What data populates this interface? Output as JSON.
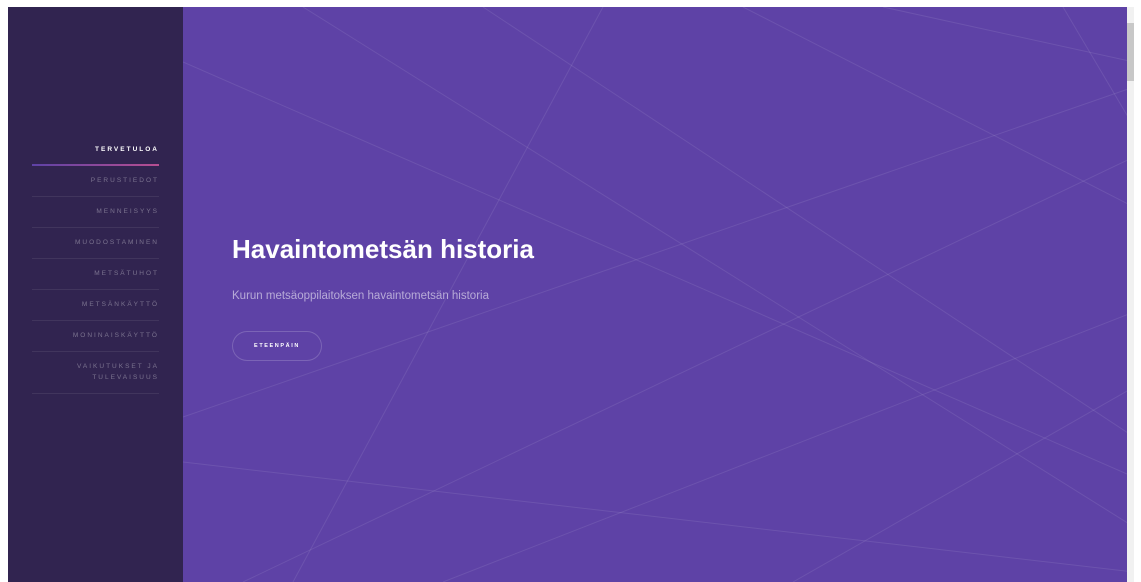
{
  "sidebar": {
    "items": [
      {
        "label": "TERVETULOA"
      },
      {
        "label": "PERUSTIEDOT"
      },
      {
        "label": "MENNEISYYS"
      },
      {
        "label": "MUODOSTAMINEN"
      },
      {
        "label": "METSÄTUHOT"
      },
      {
        "label": "METSÄNKÄYTTÖ"
      },
      {
        "label": "MONINAISKÄYTTÖ"
      },
      {
        "label": "VAIKUTUKSET JA TULEVAISUUS"
      }
    ],
    "active_index": 0
  },
  "hero": {
    "title": "Havaintometsän historia",
    "subtitle": "Kurun metsäoppilaitoksen havaintometsän historia",
    "button_label": "ETEENPÄIN"
  },
  "colors": {
    "sidebar_bg": "#312450",
    "main_bg": "#5e42a6",
    "active_underline_start": "#5e42a6",
    "active_underline_end": "#b74e91"
  }
}
